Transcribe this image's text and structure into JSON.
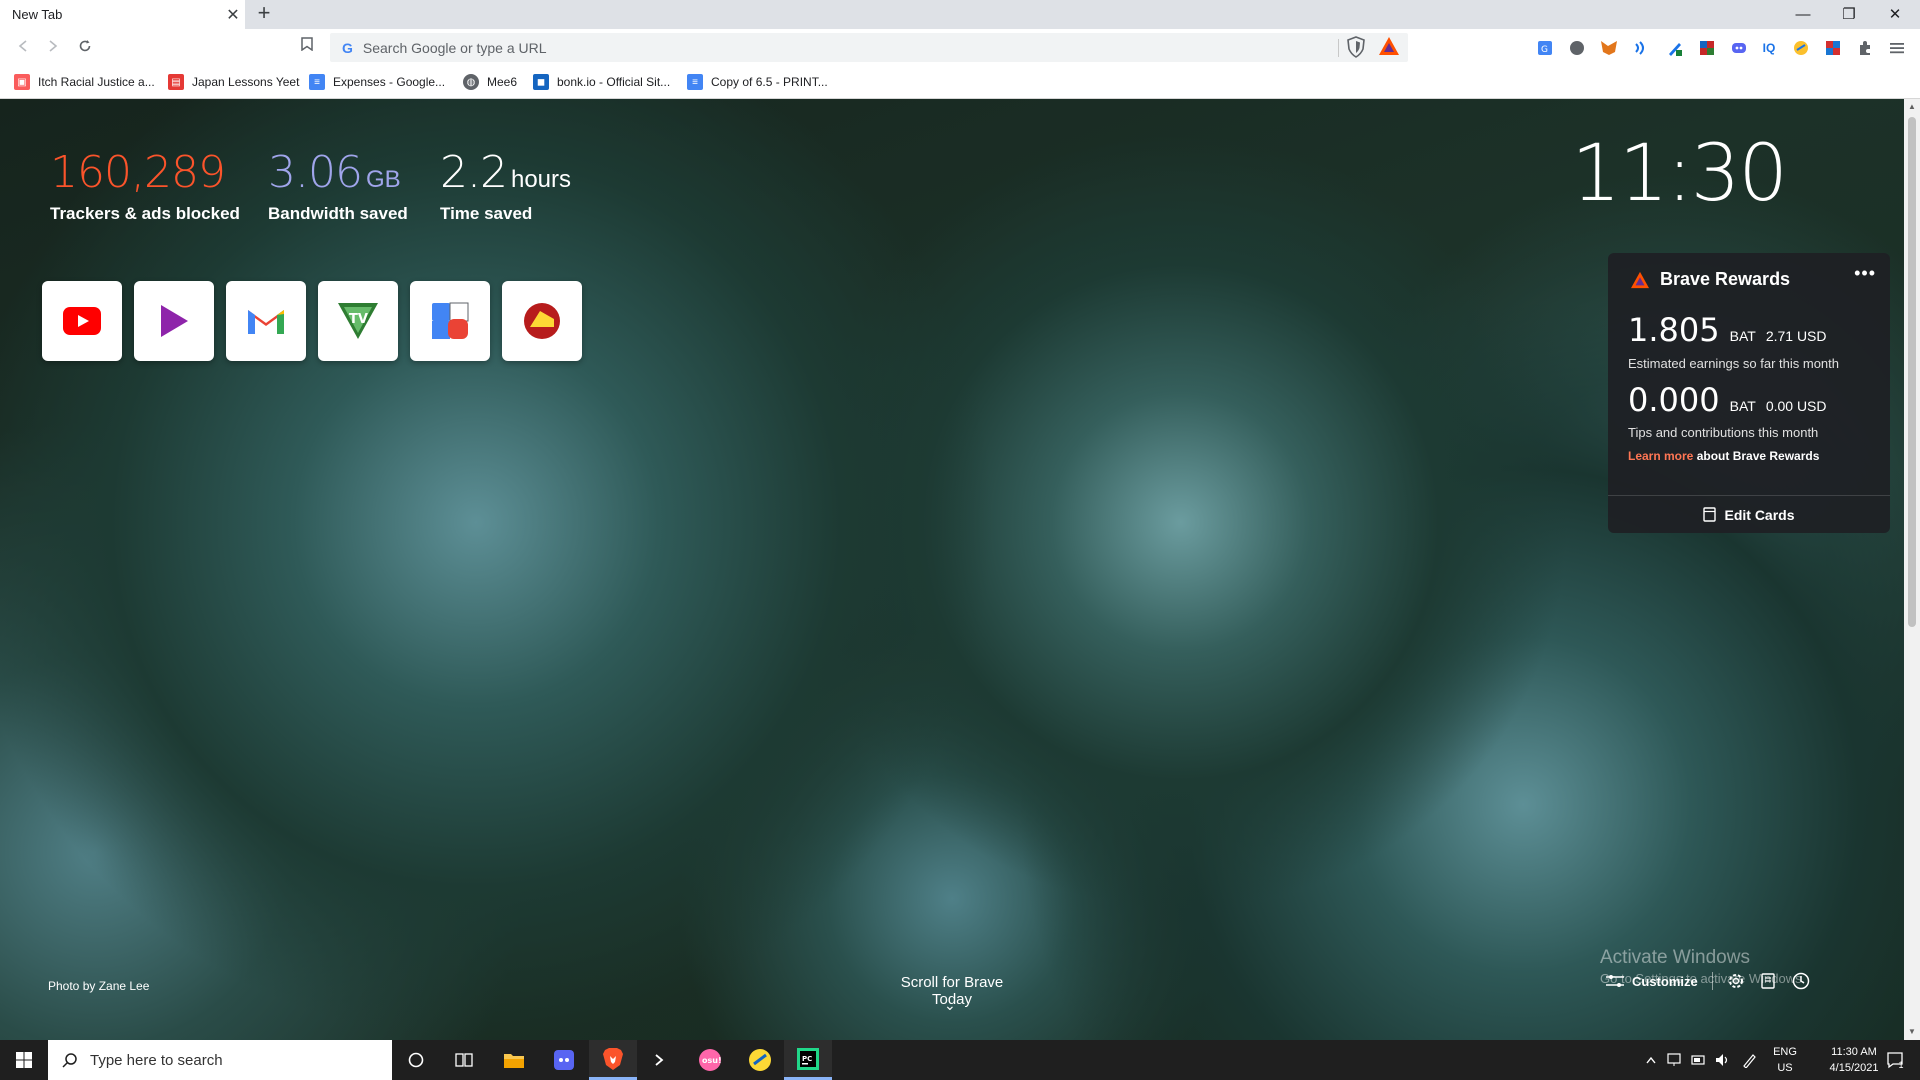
{
  "browser": {
    "tab_title": "New Tab",
    "tab_close": "✕",
    "new_tab": "+",
    "window_controls": {
      "minimize": "—",
      "restore": "❐",
      "close": "✕"
    },
    "omnibox_placeholder": "Search Google or type a URL",
    "extensions": [
      "translate-icon",
      "record-icon",
      "metamask-icon",
      "audio-icon",
      "pen-icon",
      "flag-icon",
      "discord-icon",
      "iq-icon",
      "honey-icon",
      "tile-icon",
      "extensions-puzzle-icon",
      "menu-icon"
    ]
  },
  "bookmarks": [
    {
      "label": "Itch Racial Justice a...",
      "color": "#fa5c5c",
      "icon": "itch-icon"
    },
    {
      "label": "Japan Lessons Yeet",
      "color": "#e53935",
      "icon": "japan-icon"
    },
    {
      "label": "Expenses - Google...",
      "color": "#4285f4",
      "icon": "sheets-icon"
    },
    {
      "label": "Mee6",
      "color": "#5f6368",
      "icon": "globe-icon"
    },
    {
      "label": "bonk.io - Official Sit...",
      "color": "#1565c0",
      "icon": "bonk-icon"
    },
    {
      "label": "Copy of 6.5 - PRINT...",
      "color": "#4285f4",
      "icon": "docs-icon"
    }
  ],
  "stats": {
    "trackers": {
      "value": "160,289",
      "label": "Trackers & ads blocked",
      "color": "#fb542b"
    },
    "bandwidth": {
      "value": "3.06",
      "unit": "GB",
      "label": "Bandwidth saved",
      "color": "#a0a5eb"
    },
    "time": {
      "value": "2.2",
      "unit": "hours",
      "label": "Time saved",
      "color": "#ffffff"
    }
  },
  "clock": "11:30",
  "top_sites": [
    {
      "name": "youtube",
      "icon": "youtube-icon"
    },
    {
      "name": "play",
      "icon": "play-icon"
    },
    {
      "name": "gmail",
      "icon": "gmail-icon"
    },
    {
      "name": "tv",
      "icon": "tv-icon"
    },
    {
      "name": "apps",
      "icon": "apps-icon"
    },
    {
      "name": "cheese",
      "icon": "cheese-icon"
    }
  ],
  "rewards": {
    "title": "Brave Rewards",
    "menu": "•••",
    "earnings_bat": "1.805",
    "earnings_bat_unit": "BAT",
    "earnings_usd": "2.71 USD",
    "earnings_desc": "Estimated earnings so far this month",
    "tips_bat": "0.000",
    "tips_bat_unit": "BAT",
    "tips_usd": "0.00 USD",
    "tips_desc": "Tips and contributions this month",
    "learn_more": "Learn more",
    "learn_more_rest": " about Brave Rewards",
    "edit_cards": "Edit Cards"
  },
  "footer": {
    "photo_credit": "Photo by Zane Lee",
    "scroll_today": "Scroll for Brave Today",
    "chevron": "⌄",
    "activate_title": "Activate Windows",
    "activate_sub": "Go to Settings to activate Windows.",
    "customize": "Customize"
  },
  "taskbar": {
    "search_placeholder": "Type here to search",
    "lang": "ENG",
    "region": "US",
    "time": "11:30 AM",
    "date": "4/15/2021",
    "notification_count": "1"
  }
}
